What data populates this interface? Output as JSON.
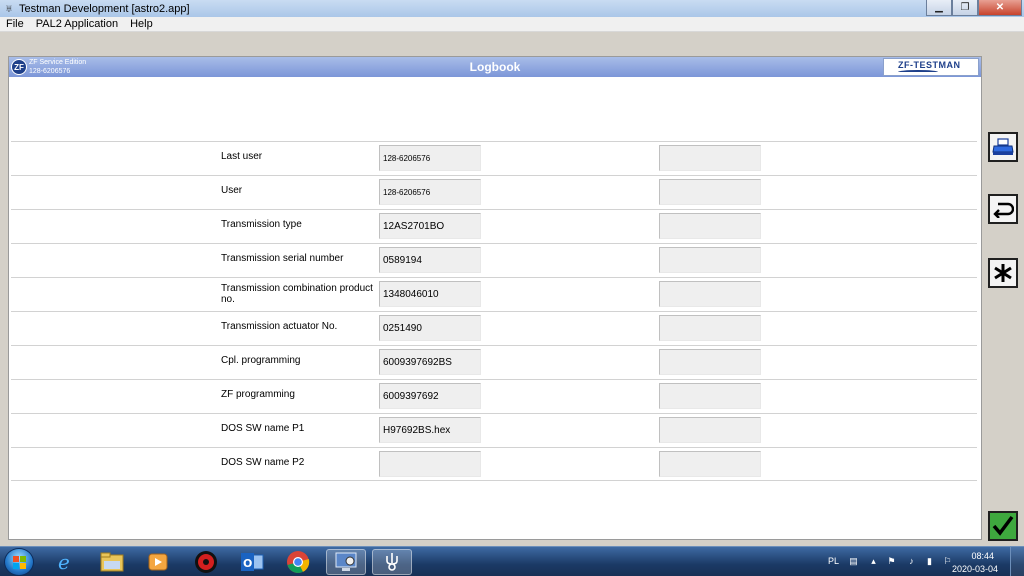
{
  "window": {
    "title": "Testman Development [astro2.app]",
    "controls": [
      "minimize",
      "maximize",
      "close"
    ]
  },
  "menu": [
    "File",
    "PAL2 Application",
    "Help"
  ],
  "header": {
    "logo_text": "ZF",
    "edition_line1": "ZF Service Edition",
    "edition_line2": "128-6206576",
    "title": "Logbook",
    "brand": "ZF-TESTMAN"
  },
  "rows": [
    {
      "label": "Last user",
      "value": "128-6206576",
      "value2": ""
    },
    {
      "label": "User",
      "value": "128-6206576",
      "value2": ""
    },
    {
      "label": "Transmission type",
      "value": "12AS2701BO",
      "value2": ""
    },
    {
      "label": "Transmission serial number",
      "value": "0589194",
      "value2": ""
    },
    {
      "label": "Transmission combination product no.",
      "value": "1348046010",
      "value2": ""
    },
    {
      "label": "Transmission actuator No.",
      "value": "0251490",
      "value2": ""
    },
    {
      "label": "Cpl. programming",
      "value": "6009397692BS",
      "value2": ""
    },
    {
      "label": "ZF programming",
      "value": "6009397692",
      "value2": ""
    },
    {
      "label": "DOS SW name P1",
      "value": "H97692BS.hex",
      "value2": ""
    },
    {
      "label": "DOS SW name P2",
      "value": "",
      "value2": ""
    }
  ],
  "tools": [
    "print-icon",
    "back-icon",
    "asterisk-icon",
    "checkmark-icon"
  ],
  "taskbar": {
    "apps": [
      "internet-explorer-icon",
      "file-explorer-icon",
      "media-player-icon",
      "record-icon",
      "outlook-icon",
      "chrome-icon",
      "remote-app-icon",
      "testman-icon"
    ],
    "language": "PL",
    "time": "08:44",
    "date": "2020-03-04"
  }
}
